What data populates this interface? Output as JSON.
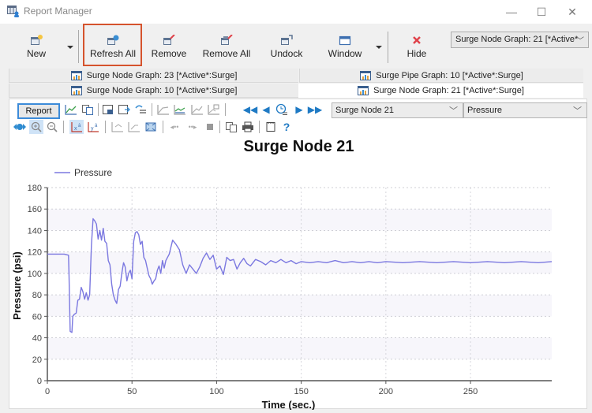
{
  "window": {
    "title": "Report Manager",
    "controls": {
      "minimize": "—",
      "maximize": "☐",
      "close": "✕"
    }
  },
  "ribbon": {
    "buttons": [
      {
        "id": "new",
        "label": "New",
        "icon": "new-report-icon",
        "has_dropdown": true
      },
      {
        "id": "refresh_all",
        "label": "Refresh All",
        "icon": "refresh-icon",
        "highlighted": true
      },
      {
        "id": "remove",
        "label": "Remove",
        "icon": "remove-icon"
      },
      {
        "id": "remove_all",
        "label": "Remove All",
        "icon": "remove-all-icon"
      },
      {
        "id": "undock",
        "label": "Undock",
        "icon": "undock-icon"
      },
      {
        "id": "window",
        "label": "Window",
        "icon": "window-icon",
        "has_dropdown": true
      },
      {
        "id": "hide",
        "label": "Hide",
        "icon": "close-x-icon"
      }
    ],
    "graph_selector": {
      "value": "Surge Node Graph: 21 [*Active*:Surge]",
      "visible_text": "Surge Node Graph: 21 [*Active*"
    }
  },
  "tabs": [
    {
      "label": "Surge Node Graph: 23 [*Active*:Surge]",
      "active": false
    },
    {
      "label": "Surge Pipe Graph: 10 [*Active*:Surge]",
      "active": false
    },
    {
      "label": "Surge Node Graph: 10 [*Active*:Surge]",
      "active": false
    },
    {
      "label": "Surge Node Graph: 21 [*Active*:Surge]",
      "active": true
    }
  ],
  "graph_toolbar": {
    "report_label": "Report",
    "element_combo": "Surge Node 21",
    "attribute_combo": "Pressure",
    "help_label": "?"
  },
  "colors": {
    "series": "#7b78e0",
    "highlight_border": "#d5532d",
    "hide_icon": "#e0424a",
    "nav_blue": "#1f7ac4"
  },
  "chart_data": {
    "type": "line",
    "title": "Surge Node 21",
    "xlabel": "Time (sec.)",
    "ylabel": "Pressure (psi)",
    "xlim": [
      0,
      298
    ],
    "ylim": [
      0,
      180
    ],
    "xticks": [
      0,
      50,
      100,
      150,
      200,
      250
    ],
    "yticks": [
      0,
      20,
      40,
      60,
      80,
      100,
      120,
      140,
      160,
      180
    ],
    "grid": true,
    "legend": {
      "position": "top-left",
      "entries": [
        "Pressure"
      ]
    },
    "series": [
      {
        "name": "Pressure",
        "x": [
          0,
          5,
          10,
          12.5,
          12.8,
          13.5,
          14.5,
          15,
          16,
          17,
          18,
          19,
          20,
          21,
          22,
          23,
          24,
          25,
          26,
          27,
          28,
          29,
          30,
          31,
          32,
          33,
          34,
          35,
          36,
          37,
          38,
          39,
          40,
          41,
          42,
          43,
          44,
          45,
          46,
          47,
          48,
          49,
          50,
          51,
          52,
          53,
          54,
          55,
          56,
          57,
          58,
          59,
          60,
          61,
          62,
          63,
          64,
          65,
          66,
          67,
          68,
          69,
          70,
          72,
          74,
          76,
          78,
          80,
          82,
          84,
          86,
          88,
          90,
          92,
          94,
          96,
          98,
          100,
          102,
          104,
          106,
          108,
          110,
          112,
          114,
          116,
          118,
          120,
          123,
          126,
          129,
          132,
          135,
          138,
          141,
          144,
          147,
          150,
          155,
          160,
          165,
          170,
          175,
          180,
          185,
          190,
          195,
          200,
          210,
          220,
          230,
          240,
          250,
          260,
          270,
          280,
          290,
          298
        ],
        "y": [
          118,
          118,
          118,
          117,
          100,
          46,
          45,
          60,
          62,
          63,
          75,
          76,
          87,
          83,
          76,
          82,
          75,
          80,
          126,
          151,
          149,
          146,
          132,
          140,
          131,
          142,
          130,
          128,
          112,
          108,
          90,
          80,
          75,
          72,
          85,
          88,
          100,
          110,
          106,
          93,
          100,
          103,
          95,
          130,
          138,
          139,
          136,
          127,
          130,
          115,
          112,
          105,
          98,
          95,
          90,
          93,
          95,
          103,
          107,
          100,
          112,
          105,
          112,
          118,
          131,
          127,
          122,
          108,
          100,
          108,
          104,
          100,
          106,
          114,
          119,
          113,
          117,
          104,
          107,
          99,
          115,
          112,
          113,
          104,
          110,
          114,
          109,
          107,
          113,
          111,
          108,
          112,
          110,
          113,
          110,
          112,
          109,
          111,
          110,
          111,
          110,
          112,
          110,
          111,
          110,
          111,
          110,
          111,
          110,
          111,
          110,
          111,
          110,
          111,
          110,
          111,
          110,
          111
        ]
      }
    ]
  }
}
